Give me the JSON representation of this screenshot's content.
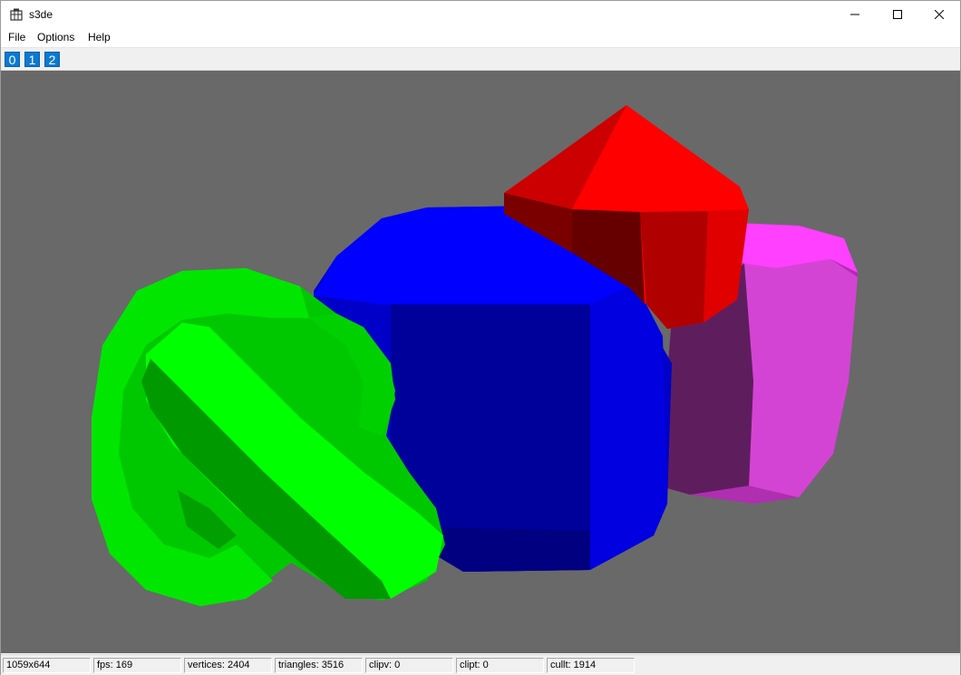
{
  "window": {
    "title": "s3de"
  },
  "menu": {
    "file": "File",
    "options": "Options",
    "help": "Help"
  },
  "toolbar": {
    "buttons": [
      "0",
      "1",
      "2"
    ]
  },
  "status": {
    "size": "1059x644",
    "fps": "fps: 169",
    "vertices": "vertices: 2404",
    "triangles": "triangles: 3516",
    "clipv": "clipv: 0",
    "clipt": "clipt: 0",
    "cullt": "cullt: 1914"
  },
  "scene": {
    "background": "#696969",
    "objects": [
      {
        "name": "green torus knot",
        "color": "#00ff00"
      },
      {
        "name": "blue rounded cube",
        "color": "#0000ff"
      },
      {
        "name": "red cone",
        "color": "#ff0000"
      },
      {
        "name": "magenta cylinder",
        "color": "#ff40ff"
      }
    ]
  },
  "icons": [
    "app-icon",
    "minimize-icon",
    "maximize-icon",
    "close-icon"
  ]
}
